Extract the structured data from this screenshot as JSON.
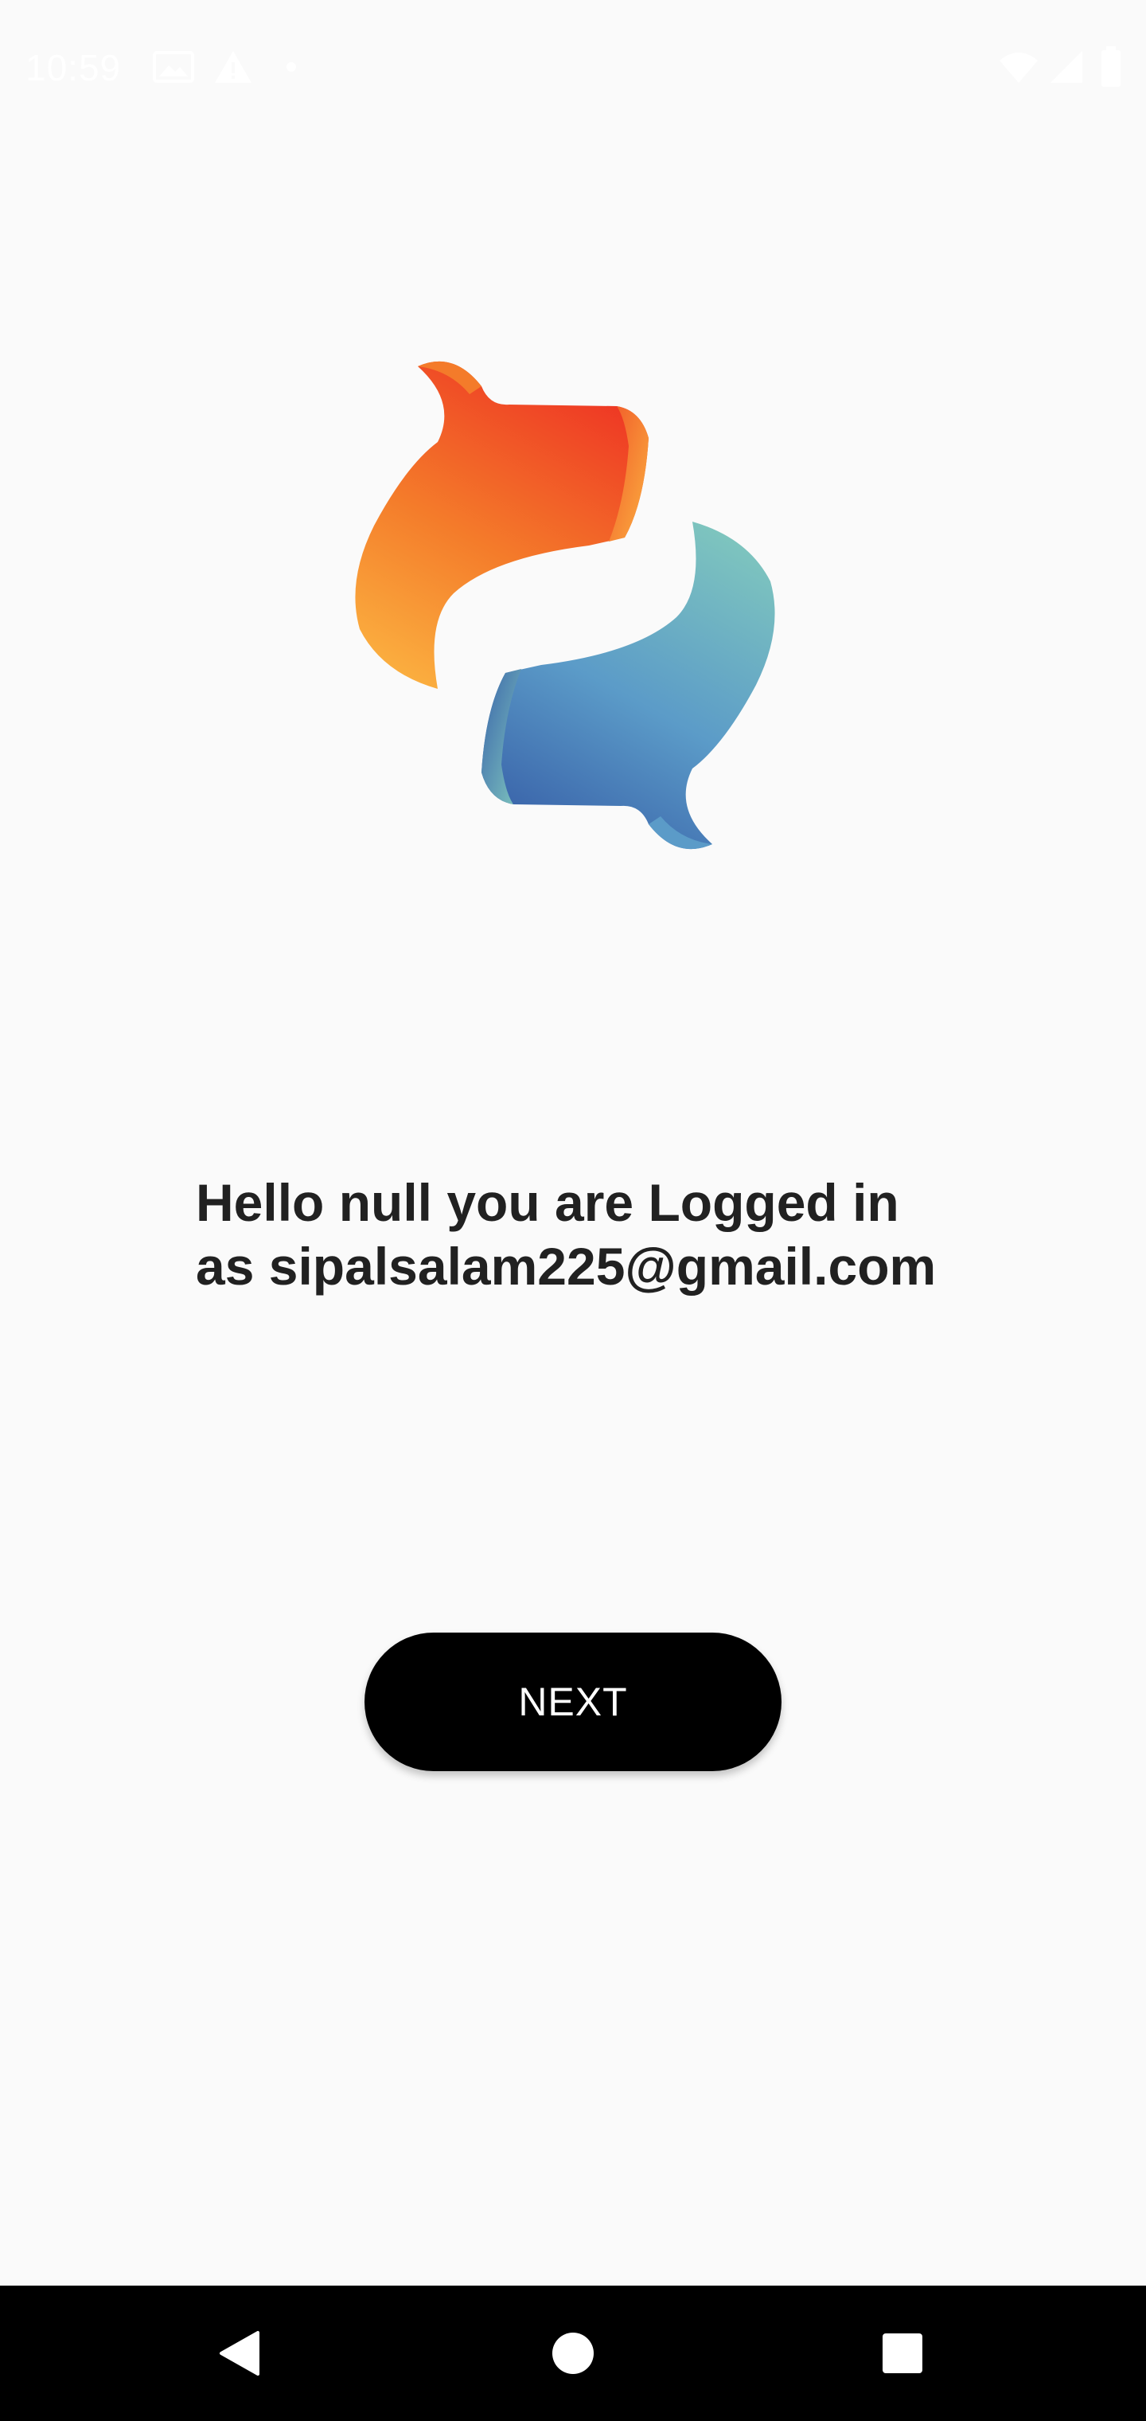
{
  "status_bar": {
    "time": "10:59",
    "left_icons": [
      "image-icon",
      "warning-icon",
      "dot-icon"
    ],
    "right_icons": [
      "wifi-icon",
      "signal-icon",
      "battery-icon"
    ]
  },
  "logo": {
    "icon": "app-logo",
    "colors": {
      "warm_top": "#ee3524",
      "warm_mid": "#f47b2a",
      "warm_bottom": "#fbb040",
      "cool_top": "#7fc6be",
      "cool_mid": "#5b9bc8",
      "cool_bottom": "#3a64aa"
    }
  },
  "message": {
    "line1": "Hello null you are Logged in",
    "line2": "as sipalsalam225@gmail.com"
  },
  "next_button": {
    "label": "NEXT"
  },
  "nav_bar": {
    "back_icon": "back-triangle-icon",
    "home_icon": "home-circle-icon",
    "recents_icon": "recents-square-icon"
  }
}
